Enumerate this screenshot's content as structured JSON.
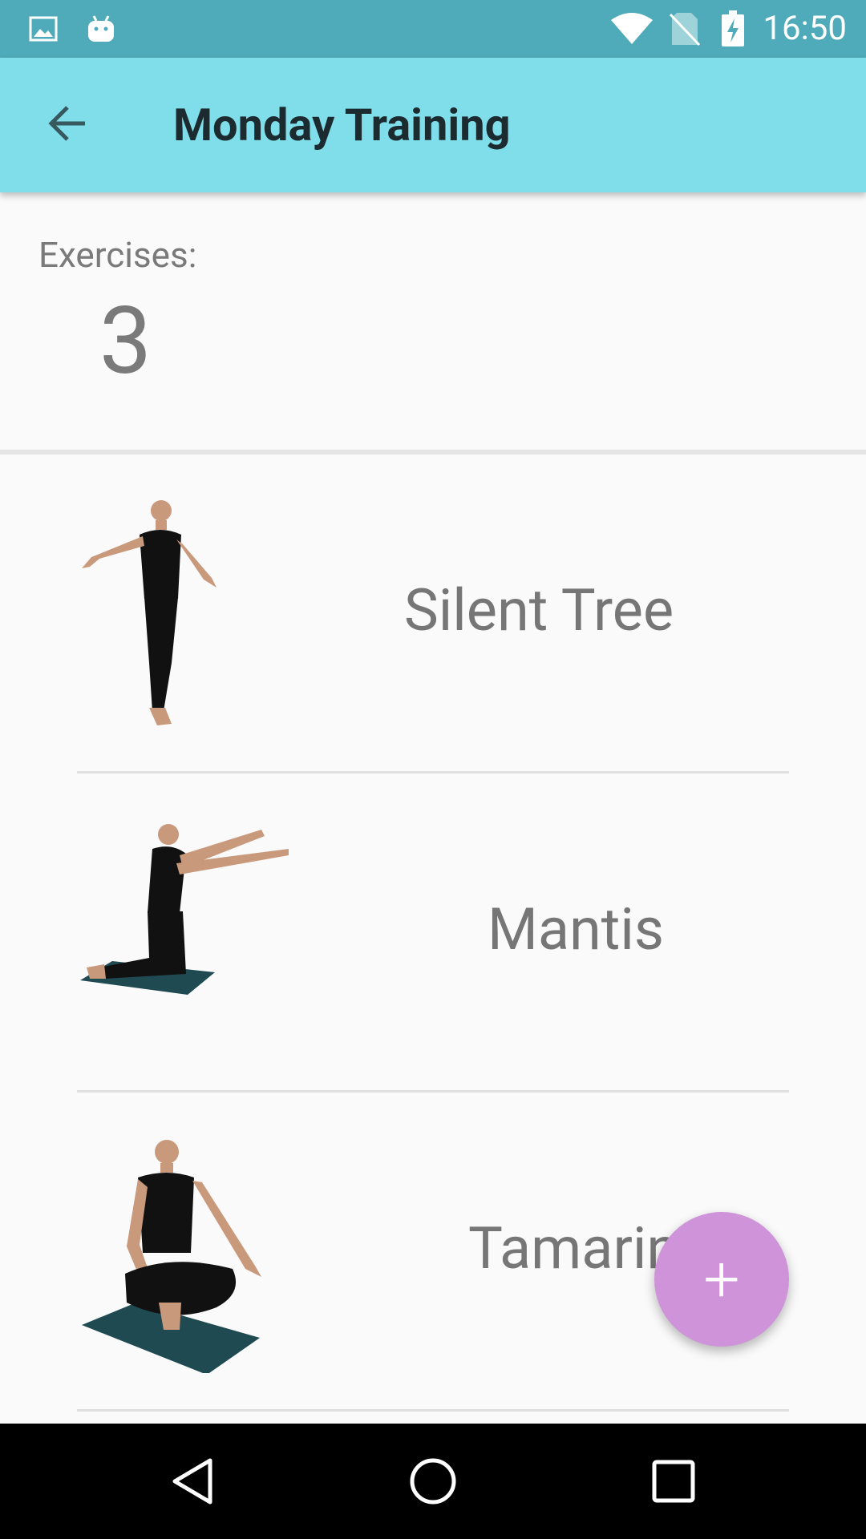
{
  "status_bar": {
    "time": "16:50",
    "icons": [
      "image-notification-icon",
      "android-notification-icon",
      "wifi-icon",
      "no-sim-icon",
      "battery-charging-icon"
    ]
  },
  "app_bar": {
    "title": "Monday Training",
    "back_icon": "arrow-back-icon"
  },
  "summary": {
    "label": "Exercises:",
    "count": "3"
  },
  "exercises": [
    {
      "name": "Silent Tree",
      "pose": "standing-arms-back"
    },
    {
      "name": "Mantis",
      "pose": "kneeling-arms-forward"
    },
    {
      "name": "Tamarin",
      "pose": "seated-cross-legged"
    }
  ],
  "fab": {
    "label": "+",
    "icon": "add-icon"
  },
  "nav_bar": {
    "buttons": [
      "back-triangle-icon",
      "home-circle-icon",
      "recents-square-icon"
    ]
  },
  "colors": {
    "status_bar": "#4fabb9",
    "app_bar": "#80deea",
    "fab": "#ce93d8",
    "text_secondary": "#767676"
  }
}
